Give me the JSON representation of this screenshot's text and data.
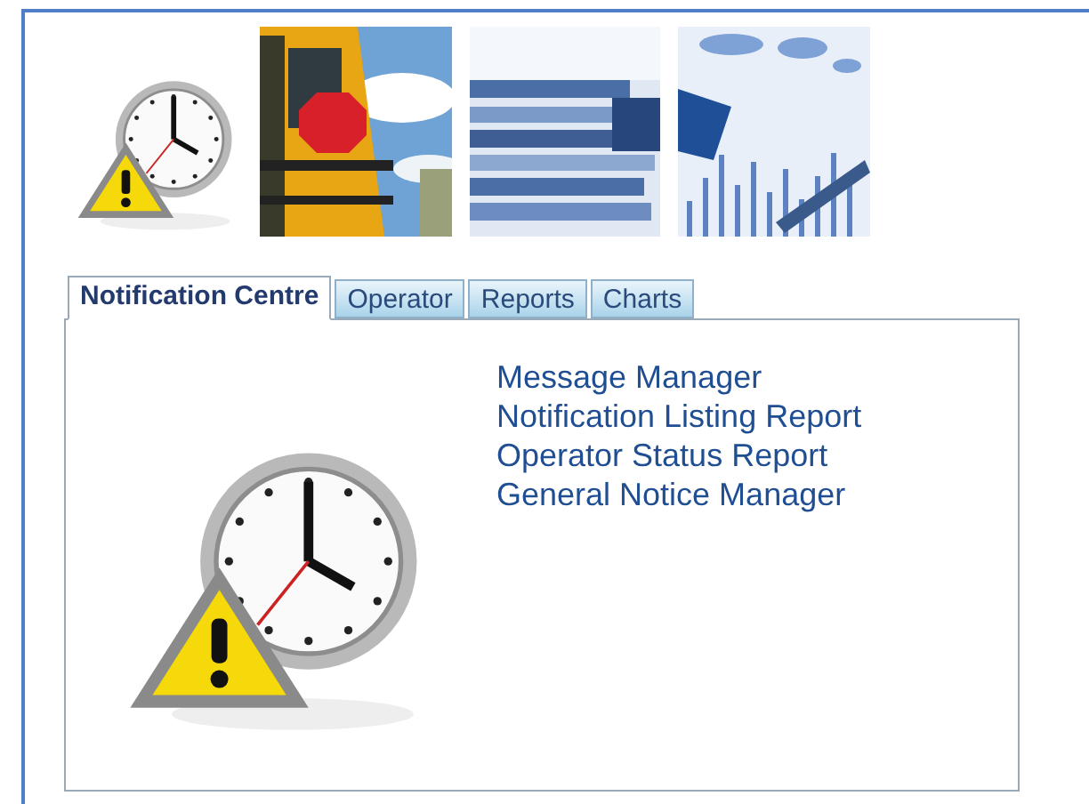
{
  "tabs": [
    {
      "label": "Notification Centre",
      "selected": true
    },
    {
      "label": "Operator",
      "selected": false
    },
    {
      "label": "Reports",
      "selected": false
    },
    {
      "label": "Charts",
      "selected": false
    }
  ],
  "links": [
    "Message Manager",
    "Notification Listing Report",
    "Operator Status Report",
    "General Notice Manager"
  ]
}
